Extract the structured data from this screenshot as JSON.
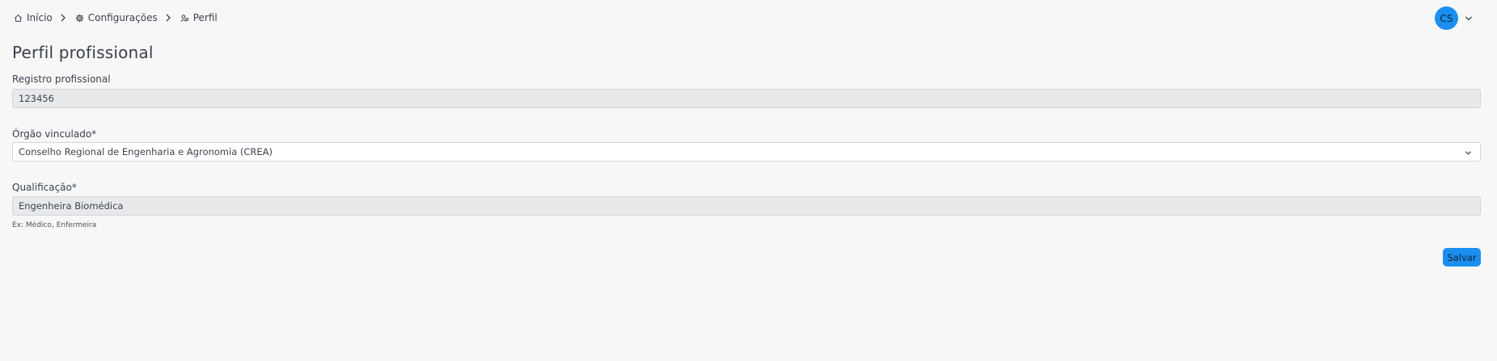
{
  "breadcrumb": {
    "home": {
      "label": "Início",
      "icon": "home-icon"
    },
    "settings": {
      "label": "Configurações",
      "icon": "settings-icon"
    },
    "profile": {
      "label": "Perfil",
      "icon": "profile-icon"
    }
  },
  "user": {
    "initials": "CS",
    "avatar_color": "#1b8ff0"
  },
  "page": {
    "title": "Perfil profissional"
  },
  "form": {
    "registro": {
      "label": "Registro profissional",
      "value": "123456"
    },
    "orgao": {
      "label": "Órgão vinculado*",
      "value": "Conselho Regional de Engenharia e Agronomia (CREA)"
    },
    "qualificacao": {
      "label": "Qualificação*",
      "value": "Engenheira Biomédica",
      "help": "Ex: Médico, Enfermeira"
    },
    "save_label": "Salvar"
  },
  "colors": {
    "accent": "#1b8ff0",
    "background": "#f6f7f6",
    "readonly_field": "#e8e9eb"
  }
}
